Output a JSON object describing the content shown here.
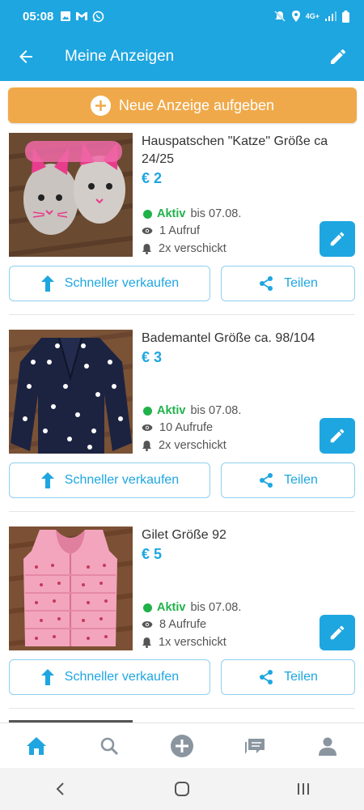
{
  "status_bar": {
    "time": "05:08",
    "network": "4G+"
  },
  "header": {
    "title": "Meine Anzeigen"
  },
  "new_ad_button": {
    "label": "Neue Anzeige aufgeben"
  },
  "listings": [
    {
      "title": "Hauspatschen \"Katze\" Größe ca 24/25",
      "price": "€ 2",
      "status_label": "Aktiv",
      "status_until": "bis 07.08.",
      "views": "1 Aufruf",
      "sent": "2x verschickt",
      "boost_label": "Schneller verkaufen",
      "share_label": "Teilen"
    },
    {
      "title": "Bademantel Größe ca. 98/104",
      "price": "€ 3",
      "status_label": "Aktiv",
      "status_until": "bis 07.08.",
      "views": "10 Aufrufe",
      "sent": "2x verschickt",
      "boost_label": "Schneller verkaufen",
      "share_label": "Teilen"
    },
    {
      "title": "Gilet Größe 92",
      "price": "€ 5",
      "status_label": "Aktiv",
      "status_until": "bis 07.08.",
      "views": "8 Aufrufe",
      "sent": "1x verschickt",
      "boost_label": "Schneller verkaufen",
      "share_label": "Teilen"
    }
  ],
  "bottom_nav": [
    "home-icon",
    "search-icon",
    "add-circle-icon",
    "messages-icon",
    "profile-icon"
  ],
  "colors": {
    "primary": "#1ea6e0",
    "accent": "#f0a94a",
    "active": "#1fb24a"
  }
}
